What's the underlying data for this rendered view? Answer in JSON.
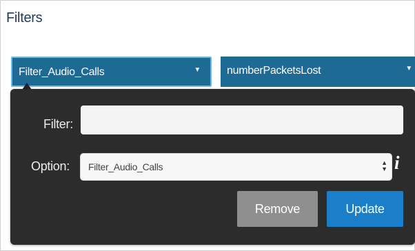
{
  "header": {
    "title": "Filters"
  },
  "selectors": {
    "filter_name": "Filter_Audio_Calls",
    "metric": "numberPacketsLost",
    "caret": "▼"
  },
  "panel": {
    "filter_label": "Filter:",
    "filter_value": "",
    "option_label": "Option:",
    "option_value": "Filter_Audio_Calls",
    "info_glyph": "i",
    "remove_label": "Remove",
    "update_label": "Update"
  },
  "colors": {
    "title": "#1e3a5f",
    "selector_bg": "#1d6b94",
    "selector_focus_border": "#6db8e6",
    "panel_bg": "#2c2c2c",
    "remove_bg": "#8f8f8f",
    "update_bg": "#1a7fc8"
  },
  "icons": {
    "dropdown": "chevron-down-icon",
    "stepper": "up-down-arrows-icon",
    "info": "info-icon"
  }
}
